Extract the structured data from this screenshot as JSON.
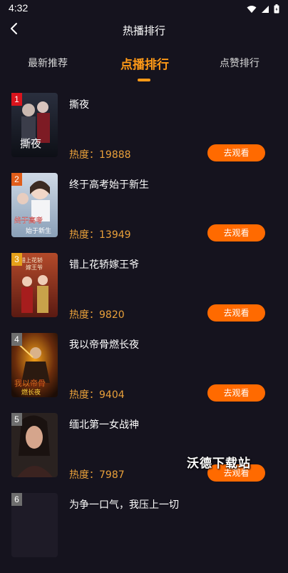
{
  "status_bar": {
    "time": "4:32"
  },
  "header": {
    "title": "热播排行"
  },
  "tabs": [
    {
      "label": "最新推荐",
      "active": false
    },
    {
      "label": "点播排行",
      "active": true
    },
    {
      "label": "点赞排行",
      "active": false
    }
  ],
  "items": [
    {
      "rank": "1",
      "title": "撕夜",
      "heat": "热度：19888",
      "action": "去观看",
      "rank_color": "#d9141d"
    },
    {
      "rank": "2",
      "title": "终于高考始于新生",
      "heat": "热度：13949",
      "action": "去观看",
      "rank_color": "#e05d1a"
    },
    {
      "rank": "3",
      "title": "错上花轿嫁王爷",
      "heat": "热度：9820",
      "action": "去观看",
      "rank_color": "#e5a11a"
    },
    {
      "rank": "4",
      "title": "我以帝骨燃长夜",
      "heat": "热度：9404",
      "action": "去观看",
      "rank_color": "#6e6e6e"
    },
    {
      "rank": "5",
      "title": "缅北第一女战神",
      "heat": "热度：7987",
      "action": "去观看",
      "rank_color": "#6e6e6e"
    },
    {
      "rank": "6",
      "title": "为争一口气，我压上一切",
      "heat": "",
      "action": "",
      "rank_color": "#6e6e6e"
    }
  ],
  "watermark": "沃德下载站",
  "colors": {
    "accent": "#ff9a17",
    "button": "#ff6a00",
    "heat_text": "#e9a03a",
    "background": "#15131e"
  }
}
